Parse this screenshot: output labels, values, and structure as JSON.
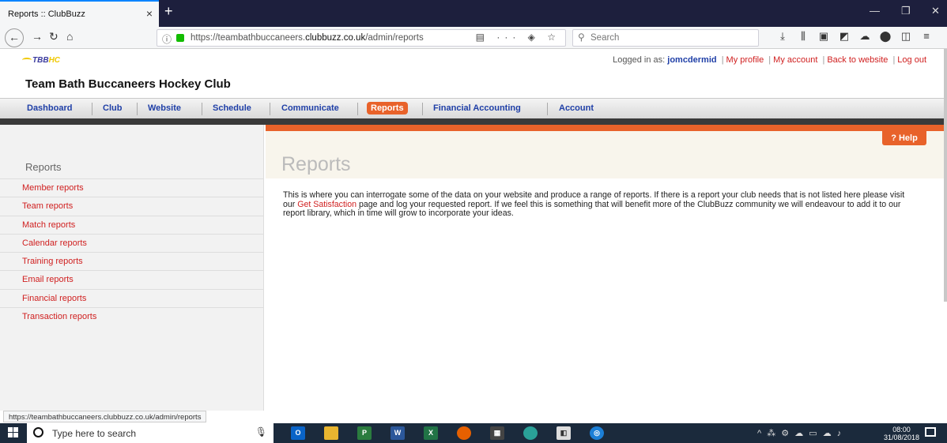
{
  "browser": {
    "tab_title": "Reports :: ClubBuzz",
    "tab_close": "×",
    "new_tab": "+",
    "win_minimize": "—",
    "win_restore": "❐",
    "win_close": "✕",
    "url_prefix": "https://teambathbuccaneers.",
    "url_domain": "clubbuzz.co.uk",
    "url_path": "/admin/reports",
    "url_actions": "▤ ··· ◈ ☆",
    "search_placeholder": "Search",
    "status_url": "https://teambathbuccaneers.clubbuzz.co.uk/admin/reports"
  },
  "site": {
    "logo_text": "TBB",
    "logo_hc": "HC",
    "club_name": "Team Bath Buccaneers Hockey Club",
    "logged_in_label": "Logged in as:",
    "username": "jomcdermid",
    "user_links": [
      "My profile",
      "My account",
      "Back to website",
      "Log out"
    ]
  },
  "menu": {
    "items": [
      "Dashboard",
      "Club",
      "Website",
      "Schedule",
      "Communicate",
      "Reports",
      "Financial Accounting",
      "Account"
    ],
    "active": "Reports"
  },
  "sidebar": {
    "title": "Reports",
    "items": [
      "Member reports",
      "Team reports",
      "Match reports",
      "Calendar reports",
      "Training reports",
      "Email reports",
      "Financial reports",
      "Transaction reports"
    ]
  },
  "content": {
    "title": "Reports",
    "help_label": "? Help",
    "intro_before": "This is where you can interrogate some of the data on your website and produce a range of reports. If there is a report your club needs that is not listed here please visit our ",
    "intro_link": "Get Satisfaction",
    "intro_after": " page and log your requested report. If we feel this is something that will benefit more of the ClubBuzz community we will endeavour to add it to our report library, which in time will grow to incorporate your ideas."
  },
  "taskbar": {
    "search_placeholder": "Type here to search",
    "time": "08:00",
    "date": "31/08/2018"
  },
  "colors": {
    "accent_orange": "#e8622a",
    "link_red": "#d02020",
    "menu_blue": "#1f3fa7"
  }
}
